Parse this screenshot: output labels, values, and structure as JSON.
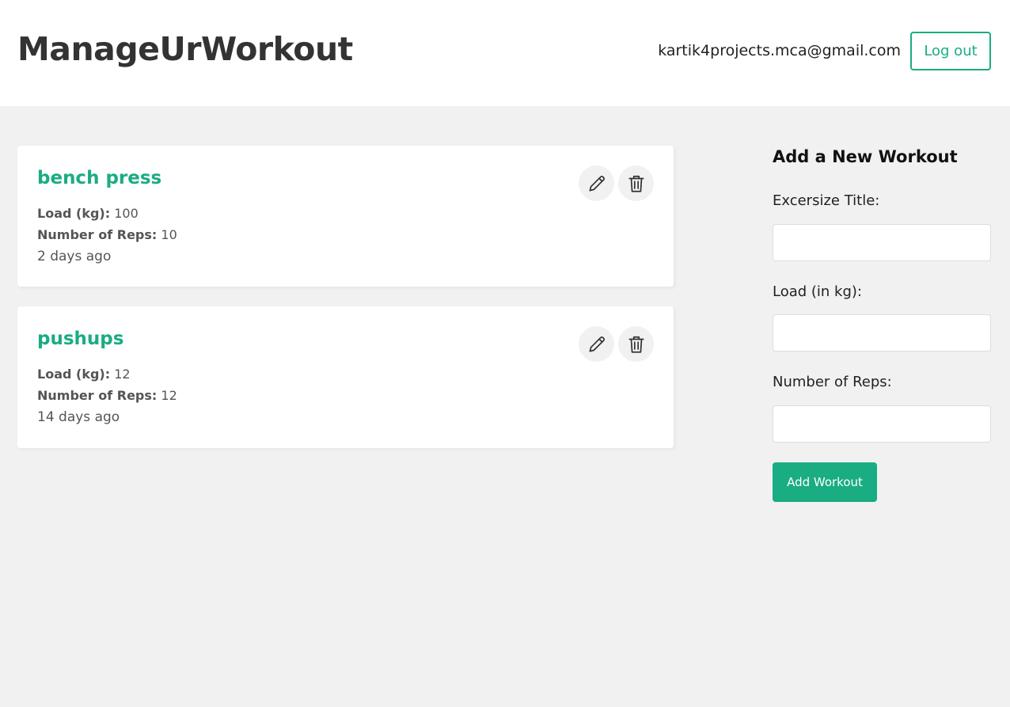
{
  "header": {
    "title": "ManageUrWorkout",
    "user_email": "kartik4projects.mca@gmail.com",
    "logout_label": "Log out"
  },
  "workouts": [
    {
      "title": "bench press",
      "load_label": "Load (kg):",
      "load": "100",
      "reps_label": "Number of Reps:",
      "reps": "10",
      "time": "2 days ago"
    },
    {
      "title": "pushups",
      "load_label": "Load (kg):",
      "load": "12",
      "reps_label": "Number of Reps:",
      "reps": "12",
      "time": "14 days ago"
    }
  ],
  "form": {
    "title": "Add a New Workout",
    "title_label": "Excersize Title:",
    "load_label": "Load (in kg):",
    "reps_label": "Number of Reps:",
    "submit_label": "Add Workout"
  },
  "icons": {
    "edit": "pencil-icon",
    "delete": "trash-icon"
  },
  "colors": {
    "accent": "#1aac83",
    "background": "#f1f1f1",
    "card": "#ffffff"
  }
}
